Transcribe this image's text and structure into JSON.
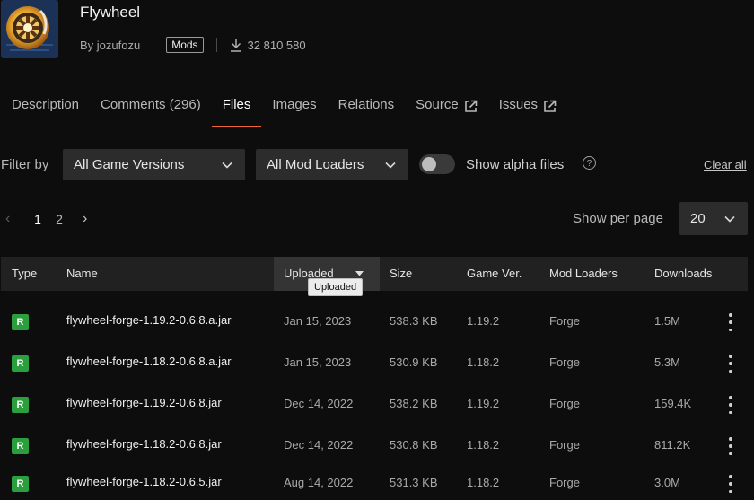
{
  "project": {
    "title": "Flywheel",
    "author": "By jozufozu",
    "category": "Mods",
    "downloads": "32 810 580",
    "accent": "#f16436"
  },
  "tabs": [
    {
      "label": "Description"
    },
    {
      "label": "Comments (296)"
    },
    {
      "label": "Files",
      "active": true
    },
    {
      "label": "Images"
    },
    {
      "label": "Relations"
    },
    {
      "label": "Source",
      "icon": "external-link-icon"
    },
    {
      "label": "Issues",
      "icon": "external-link-icon"
    }
  ],
  "filters": {
    "label": "Filter by",
    "game_versions": "All Game Versions",
    "mod_loaders": "All Mod Loaders",
    "alpha_label": "Show alpha files",
    "clear": "Clear all"
  },
  "pagination": {
    "pages": [
      "1",
      "2"
    ],
    "current": "1",
    "per_page_label": "Show per page",
    "per_page": "20"
  },
  "table": {
    "headers": {
      "type": "Type",
      "name": "Name",
      "uploaded": "Uploaded",
      "size": "Size",
      "game": "Game Ver.",
      "loaders": "Mod Loaders",
      "downloads": "Downloads"
    },
    "tooltip": "Uploaded",
    "rows": [
      {
        "type": "R",
        "name": "flywheel-forge-1.19.2-0.6.8.a.jar",
        "uploaded": "Jan 15, 2023",
        "size": "538.3 KB",
        "game": "1.19.2",
        "loader": "Forge",
        "downloads": "1.5M"
      },
      {
        "type": "R",
        "name": "flywheel-forge-1.18.2-0.6.8.a.jar",
        "uploaded": "Jan 15, 2023",
        "size": "530.9 KB",
        "game": "1.18.2",
        "loader": "Forge",
        "downloads": "5.3M"
      },
      {
        "type": "R",
        "name": "flywheel-forge-1.19.2-0.6.8.jar",
        "uploaded": "Dec 14, 2022",
        "size": "538.2 KB",
        "game": "1.19.2",
        "loader": "Forge",
        "downloads": "159.4K"
      },
      {
        "type": "R",
        "name": "flywheel-forge-1.18.2-0.6.8.jar",
        "uploaded": "Dec 14, 2022",
        "size": "530.8 KB",
        "game": "1.18.2",
        "loader": "Forge",
        "downloads": "811.2K"
      },
      {
        "type": "R",
        "name": "flywheel-forge-1.18.2-0.6.5.jar",
        "uploaded": "Aug 14, 2022",
        "size": "531.3 KB",
        "game": "1.18.2",
        "loader": "Forge",
        "downloads": "3.0M"
      }
    ]
  }
}
